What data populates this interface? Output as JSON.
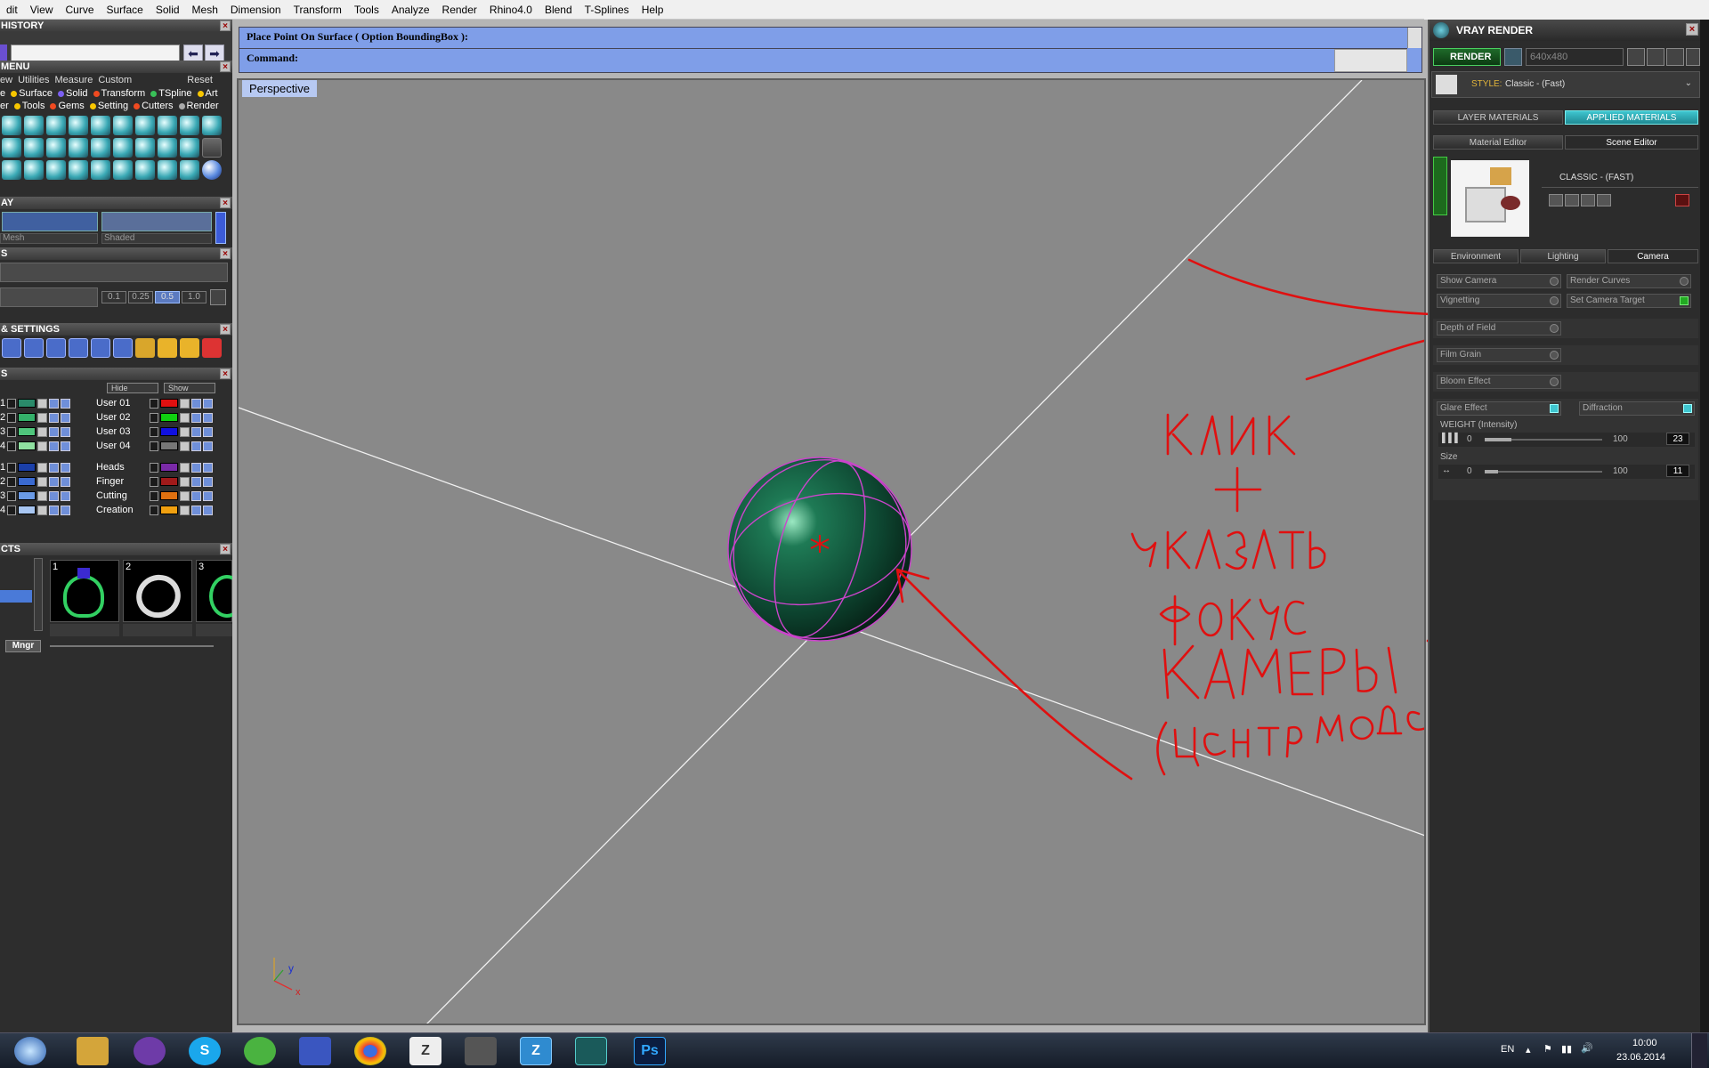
{
  "menubar": {
    "items": [
      "dit",
      "View",
      "Curve",
      "Surface",
      "Solid",
      "Mesh",
      "Dimension",
      "Transform",
      "Tools",
      "Analyze",
      "Render",
      "Rhino4.0",
      "Blend",
      "T-Splines",
      "Help"
    ]
  },
  "left": {
    "history_title": "HISTORY",
    "menu_title": "MENU",
    "menu_tabs": [
      "ew",
      "Utilities",
      "Measure",
      "Custom",
      "Reset"
    ],
    "menu_row1": [
      "e",
      "Surface",
      "Solid",
      "Transform",
      "TSpline",
      "Art"
    ],
    "menu_row2": [
      "er",
      "Tools",
      "Gems",
      "Setting",
      "Cutters",
      "Render"
    ],
    "display_title": "AY",
    "display_mesh": "Mesh",
    "display_shaded": "Shaded",
    "snap_title": "S",
    "snap_values": [
      "0.1",
      "0.25",
      "0.5",
      "1.0"
    ],
    "settings_title": "& SETTINGS",
    "layers_title": "S",
    "layers_hide": "Hide",
    "layers_show": "Show",
    "layers_left_nums": [
      "1",
      "2",
      "3",
      "4"
    ],
    "layers_left_nums2": [
      "1",
      "2",
      "3",
      "4"
    ],
    "layers_names": [
      "User 01",
      "User 02",
      "User 03",
      "User 04"
    ],
    "layers_names2": [
      "Heads",
      "Finger",
      "Cutting",
      "Creation"
    ],
    "objects_title": "CTS",
    "objects_nums": [
      "1",
      "2",
      "3"
    ],
    "objects_mngr": "Mngr"
  },
  "command": {
    "line1": "Place Point On Surface ( Option  BoundingBox ):",
    "line2_label": "Command:"
  },
  "viewport": {
    "tab": "Perspective",
    "axis_y": "y",
    "axis_x": "x"
  },
  "right": {
    "title": "VRAY RENDER",
    "render_btn": "RENDER",
    "resolution": "640x480",
    "style_label": "STYLE:",
    "style_value": "Classic - (Fast)",
    "tab_layer_materials": "LAYER MATERIALS",
    "tab_applied_materials": "APPLIED MATERIALS",
    "tab_material_editor": "Material Editor",
    "tab_scene_editor": "Scene Editor",
    "preset_name": "CLASSIC - (FAST)",
    "tab_environment": "Environment",
    "tab_lighting": "Lighting",
    "tab_camera": "Camera",
    "show_camera": "Show Camera",
    "render_curves": "Render Curves",
    "vignetting": "Vignetting",
    "set_camera_target": "Set Camera Target",
    "depth_of_field": "Depth of Field",
    "film_grain": "Film Grain",
    "bloom_effect": "Bloom Effect",
    "glare_effect": "Glare Effect",
    "diffraction": "Diffraction",
    "weight_label": "WEIGHT (Intensity)",
    "weight_min": "0",
    "weight_max": "100",
    "weight_value": "23",
    "size_label": "Size",
    "size_min": "0",
    "size_max": "100",
    "size_value": "11"
  },
  "taskbar": {
    "lang": "EN",
    "time": "10:00",
    "date": "23.06.2014",
    "ps_label": "Ps"
  },
  "colors": {
    "annotation": "#e01010",
    "sphere": "#0f5a3d",
    "wire": "#cc44cc",
    "accent_cyan": "#3fc6d0"
  }
}
